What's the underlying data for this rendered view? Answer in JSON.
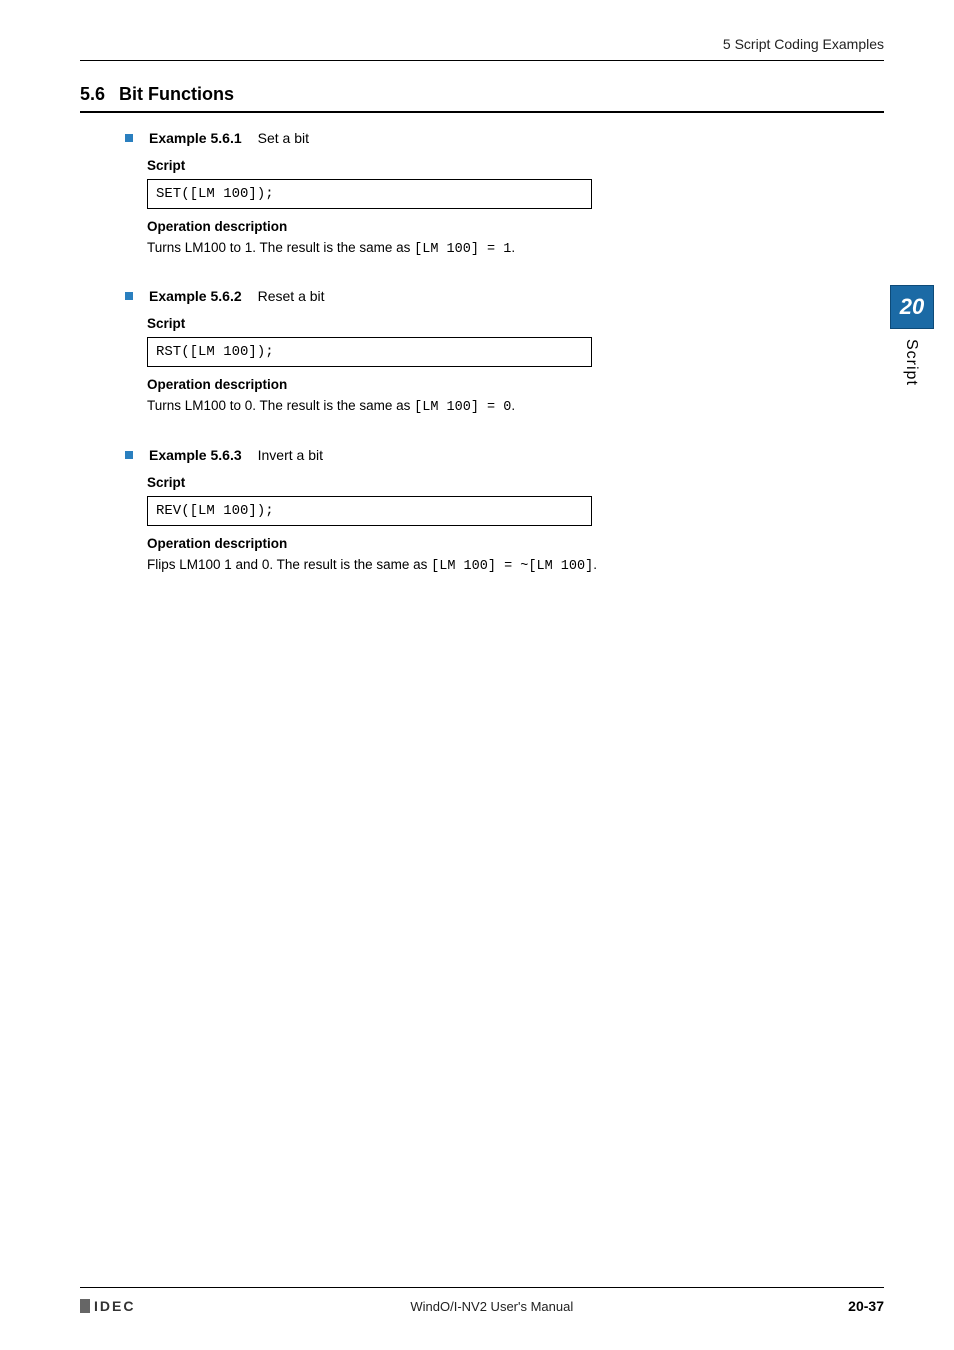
{
  "header": {
    "breadcrumb": "5 Script Coding Examples"
  },
  "section": {
    "number": "5.6",
    "title": "Bit Functions"
  },
  "examples": [
    {
      "label": "Example 5.6.1",
      "title": "Set a bit",
      "script_heading": "Script",
      "code": "SET([LM 100]);",
      "op_label": "Operation description",
      "op_pre": "Turns LM100 to 1. The result is the same as ",
      "op_code": "[LM 100] = 1",
      "op_post": "."
    },
    {
      "label": "Example 5.6.2",
      "title": "Reset a bit",
      "script_heading": "Script",
      "code": "RST([LM 100]);",
      "op_label": "Operation description",
      "op_pre": "Turns LM100 to 0. The result is the same as ",
      "op_code": "[LM 100] = 0",
      "op_post": "."
    },
    {
      "label": "Example 5.6.3",
      "title": "Invert a bit",
      "script_heading": "Script",
      "code": "REV([LM 100]);",
      "op_label": "Operation description",
      "op_pre": "Flips LM100 1 and 0. The result is the same as ",
      "op_code": "[LM 100] = ~[LM 100]",
      "op_post": "."
    }
  ],
  "sidetab": {
    "number": "20",
    "label": "Script"
  },
  "footer": {
    "logo": "IDEC",
    "center": "WindO/I-NV2 User's Manual",
    "page": "20-37"
  }
}
